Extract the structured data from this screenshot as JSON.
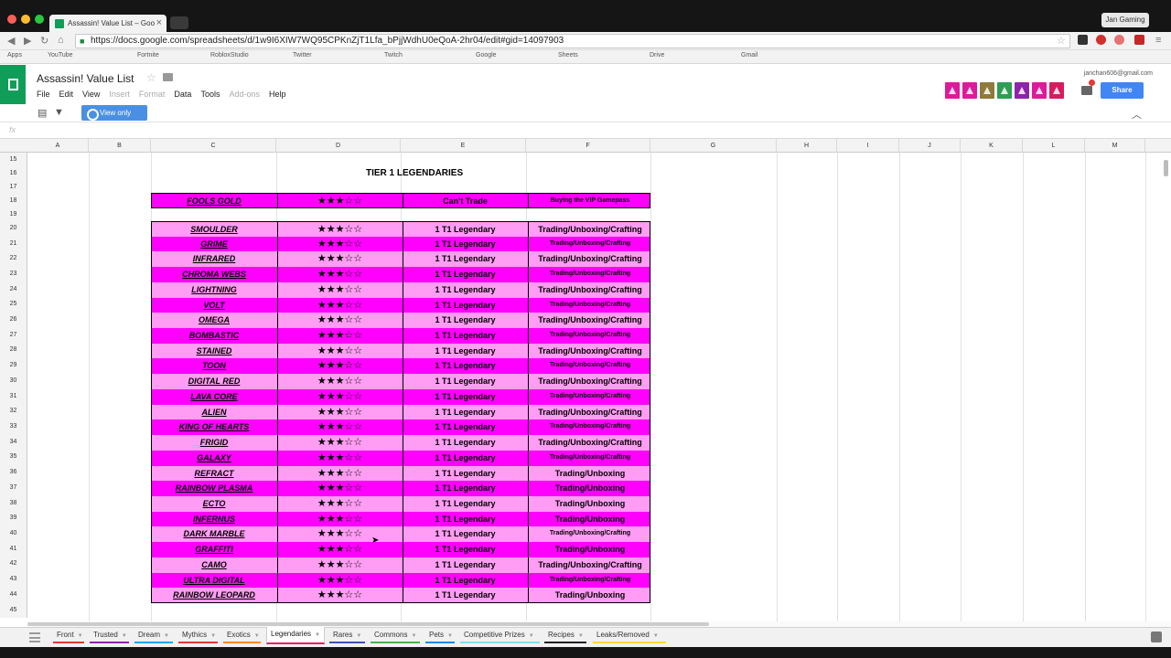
{
  "browser": {
    "tab_title": "Assassin! Value List – Goo",
    "profile": "Jan Gaming",
    "url": "https://docs.google.com/spreadsheets/d/1w9I6XIW7WQ95CPKnZjT1Lfa_bPjjWdhU0eQoA-2hr04/edit#gid=14097903",
    "bookmarks": [
      "Apps",
      "YouTube",
      "Fortnite",
      "RobloxStudio",
      "Twitter",
      "Twitch",
      "Google",
      "Sheets",
      "Drive",
      "Gmail"
    ]
  },
  "doc": {
    "title": "Assassin! Value List",
    "menu": [
      "File",
      "Edit",
      "View",
      "Insert",
      "Format",
      "Data",
      "Tools",
      "Add-ons",
      "Help"
    ],
    "menu_disabled": [
      "Insert",
      "Format",
      "Add-ons"
    ],
    "account": "janchan606@gmail.com",
    "share_label": "Share",
    "view_only_label": "View only",
    "formula_label": "fx"
  },
  "grid": {
    "columns": [
      "A",
      "B",
      "C",
      "D",
      "E",
      "F",
      "G",
      "H",
      "I",
      "J",
      "K",
      "L",
      "M"
    ],
    "rows": [
      "15",
      "16",
      "17",
      "18",
      "19",
      "20",
      "21",
      "22",
      "23",
      "24",
      "25",
      "26",
      "27",
      "28",
      "29",
      "30",
      "31",
      "32",
      "33",
      "34",
      "35",
      "36",
      "37",
      "38",
      "39",
      "40",
      "41",
      "42",
      "43",
      "44",
      "45"
    ],
    "section_title": "TIER 1  LEGENDARIES",
    "rating": "★★★☆☆",
    "first_item": {
      "name": "FOOLS GOLD",
      "value": "Can't Trade",
      "obtain": "Buying the VIP Gamepass"
    },
    "items": [
      {
        "name": "SMOULDER",
        "value": "1 T1 Legendary",
        "obtain": "Trading/Unboxing/Crafting"
      },
      {
        "name": "GRIME",
        "value": "1 T1 Legendary",
        "obtain": "Trading/Unboxing/Crafting"
      },
      {
        "name": "INFRARED",
        "value": "1 T1 Legendary",
        "obtain": "Trading/Unboxing/Crafting"
      },
      {
        "name": "CHROMA WEBS",
        "value": "1 T1 Legendary",
        "obtain": "Trading/Unboxing/Crafting"
      },
      {
        "name": "LIGHTNING",
        "value": "1 T1 Legendary",
        "obtain": "Trading/Unboxing/Crafting"
      },
      {
        "name": "VOLT",
        "value": "1 T1 Legendary",
        "obtain": "Trading/Unboxing/Crafting"
      },
      {
        "name": "OMEGA",
        "value": "1 T1 Legendary",
        "obtain": "Trading/Unboxing/Crafting"
      },
      {
        "name": "BOMBASTIC",
        "value": "1 T1 Legendary",
        "obtain": "Trading/Unboxing/Crafting"
      },
      {
        "name": "STAINED",
        "value": "1 T1 Legendary",
        "obtain": "Trading/Unboxing/Crafting"
      },
      {
        "name": "TOON",
        "value": "1 T1 Legendary",
        "obtain": "Trading/Unboxing/Crafting"
      },
      {
        "name": "DIGITAL RED",
        "value": "1 T1 Legendary",
        "obtain": "Trading/Unboxing/Crafting"
      },
      {
        "name": "LAVA CORE",
        "value": "1 T1 Legendary",
        "obtain": "Trading/Unboxing/Crafting"
      },
      {
        "name": "ALIEN",
        "value": "1 T1 Legendary",
        "obtain": "Trading/Unboxing/Crafting"
      },
      {
        "name": "KING OF HEARTS",
        "value": "1 T1 Legendary",
        "obtain": "Trading/Unboxing/Crafting"
      },
      {
        "name": "FRIGID",
        "value": "1 T1 Legendary",
        "obtain": "Trading/Unboxing/Crafting"
      },
      {
        "name": "GALAXY",
        "value": "1 T1 Legendary",
        "obtain": "Trading/Unboxing/Crafting"
      },
      {
        "name": "REFRACT",
        "value": "1 T1 Legendary",
        "obtain": "Trading/Unboxing"
      },
      {
        "name": "RAINBOW PLASMA",
        "value": "1 T1 Legendary",
        "obtain": "Trading/Unboxing"
      },
      {
        "name": "ECTO",
        "value": "1 T1 Legendary",
        "obtain": "Trading/Unboxing"
      },
      {
        "name": "INFERNUS",
        "value": "1 T1 Legendary",
        "obtain": "Trading/Unboxing"
      },
      {
        "name": "DARK MARBLE",
        "value": "1 T1 Legendary",
        "obtain": "Trading/Unboxing/Crafting"
      },
      {
        "name": "GRAFFITI",
        "value": "1 T1 Legendary",
        "obtain": "Trading/Unboxing"
      },
      {
        "name": "CAMO",
        "value": "1 T1 Legendary",
        "obtain": "Trading/Unboxing/Crafting"
      },
      {
        "name": "ULTRA DIGITAL",
        "value": "1 T1 Legendary",
        "obtain": "Trading/Unboxing/Crafting"
      },
      {
        "name": "RAINBOW LEOPARD",
        "value": "1 T1 Legendary",
        "obtain": "Trading/Unboxing"
      }
    ]
  },
  "sheet_tabs": [
    {
      "label": "Front",
      "color": "#e53935"
    },
    {
      "label": "Trusted",
      "color": "#8e24aa"
    },
    {
      "label": "Dream",
      "color": "#03a9f4"
    },
    {
      "label": "Mythics",
      "color": "#e53935"
    },
    {
      "label": "Exotics",
      "color": "#fb8c00"
    },
    {
      "label": "Legendaries",
      "color": "#e91e63"
    },
    {
      "label": "Rares",
      "color": "#3f51b5"
    },
    {
      "label": "Commons",
      "color": "#4caf50"
    },
    {
      "label": "Pets",
      "color": "#1e88e5"
    },
    {
      "label": "Competitive Prizes",
      "color": "#80deea"
    },
    {
      "label": "Recipes",
      "color": "#212121"
    },
    {
      "label": "Leaks/Removed",
      "color": "#fdd835"
    }
  ],
  "active_sheet": "Legendaries",
  "colors": {
    "row_dark": "#ff00ff",
    "row_light": "#ff9cf3",
    "accent_blue": "#4285f4",
    "sheets_green": "#0f9d58"
  }
}
